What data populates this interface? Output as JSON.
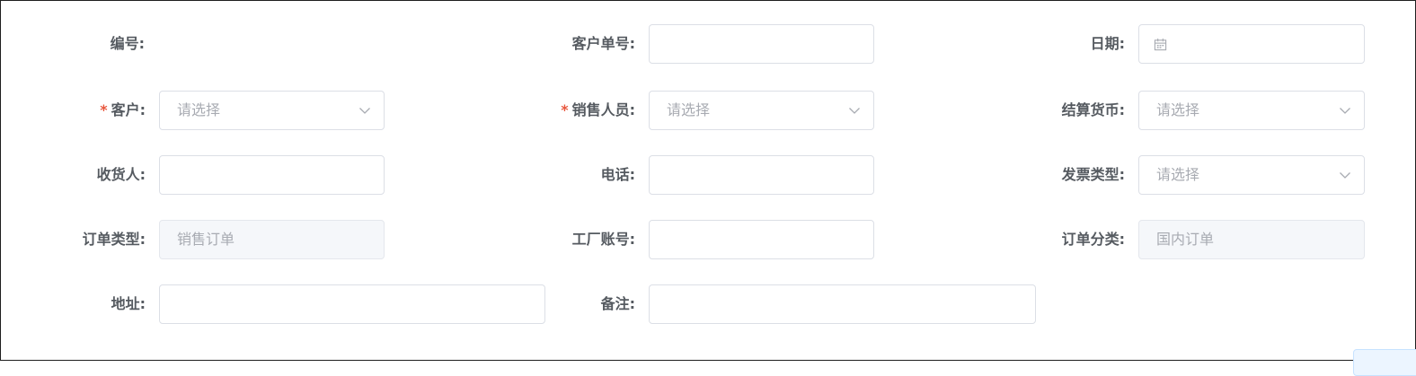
{
  "form": {
    "number": {
      "label": "编号:"
    },
    "customer_order_no": {
      "label": "客户单号:",
      "value": ""
    },
    "date": {
      "label": "日期:",
      "value": "",
      "icon": "calendar-icon"
    },
    "customer": {
      "label": "客户:",
      "required": "*",
      "placeholder": "请选择",
      "icon": "chevron-down-icon"
    },
    "salesperson": {
      "label": "销售人员:",
      "required": "*",
      "placeholder": "请选择",
      "icon": "chevron-down-icon"
    },
    "currency": {
      "label": "结算货币:",
      "placeholder": "请选择",
      "icon": "chevron-down-icon"
    },
    "receiver": {
      "label": "收货人:",
      "value": ""
    },
    "phone": {
      "label": "电话:",
      "value": ""
    },
    "invoice_type": {
      "label": "发票类型:",
      "placeholder": "请选择",
      "icon": "chevron-down-icon"
    },
    "order_type": {
      "label": "订单类型:",
      "value": "销售订单"
    },
    "factory_account": {
      "label": "工厂账号:",
      "value": ""
    },
    "order_category": {
      "label": "订单分类:",
      "value": "国内订单"
    },
    "address": {
      "label": "地址:",
      "value": ""
    },
    "remark": {
      "label": "备注:",
      "value": ""
    }
  },
  "colors": {
    "label": "#555a60",
    "required": "#e8573e",
    "border": "#dcdfe6",
    "placeholder": "#a8abb2",
    "disabled_bg": "#f5f7fa"
  }
}
